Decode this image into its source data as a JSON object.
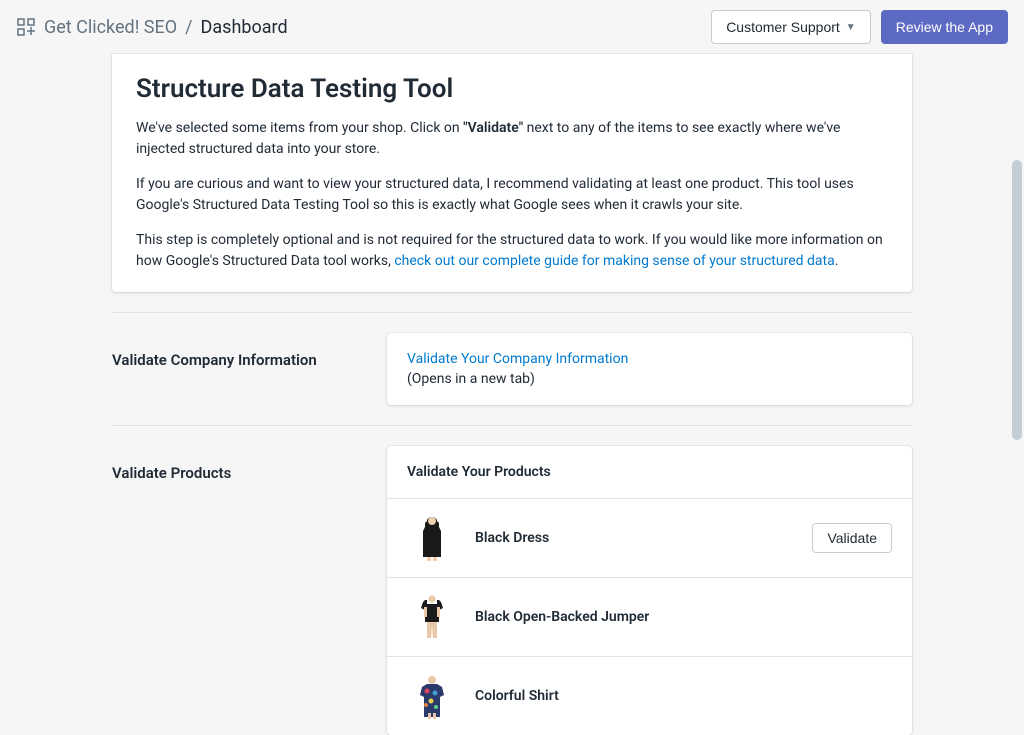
{
  "header": {
    "app_name": "Get Clicked! SEO",
    "separator": "/",
    "current_page": "Dashboard",
    "customer_support_label": "Customer Support",
    "review_app_label": "Review the App"
  },
  "intro": {
    "title": "Structure Data Testing Tool",
    "p1_before": "We've selected some items from your shop. Click on ",
    "p1_bold": "\"Validate\"",
    "p1_after": " next to any of the items to see exactly where we've injected structured data into your store.",
    "p2": "If you are curious and want to view your structured data, I recommend validating at least one product. This tool uses Google's Structured Data Testing Tool so this is exactly what Google sees when it crawls your site.",
    "p3_before": "This step is completely optional and is not required for the structured data to work. If you would like more information on how Google's Structured Data tool works, ",
    "p3_link": "check out our complete guide for making sense of your structured data",
    "p3_after": "."
  },
  "company_section": {
    "heading": "Validate Company Information",
    "link_label": "Validate Your Company Information",
    "hint": "(Opens in a new tab)"
  },
  "products_section": {
    "heading": "Validate Products",
    "card_heading": "Validate Your Products",
    "validate_button_label": "Validate",
    "items": [
      {
        "name": "Black Dress"
      },
      {
        "name": "Black Open-Backed Jumper"
      },
      {
        "name": "Colorful Shirt"
      }
    ]
  }
}
